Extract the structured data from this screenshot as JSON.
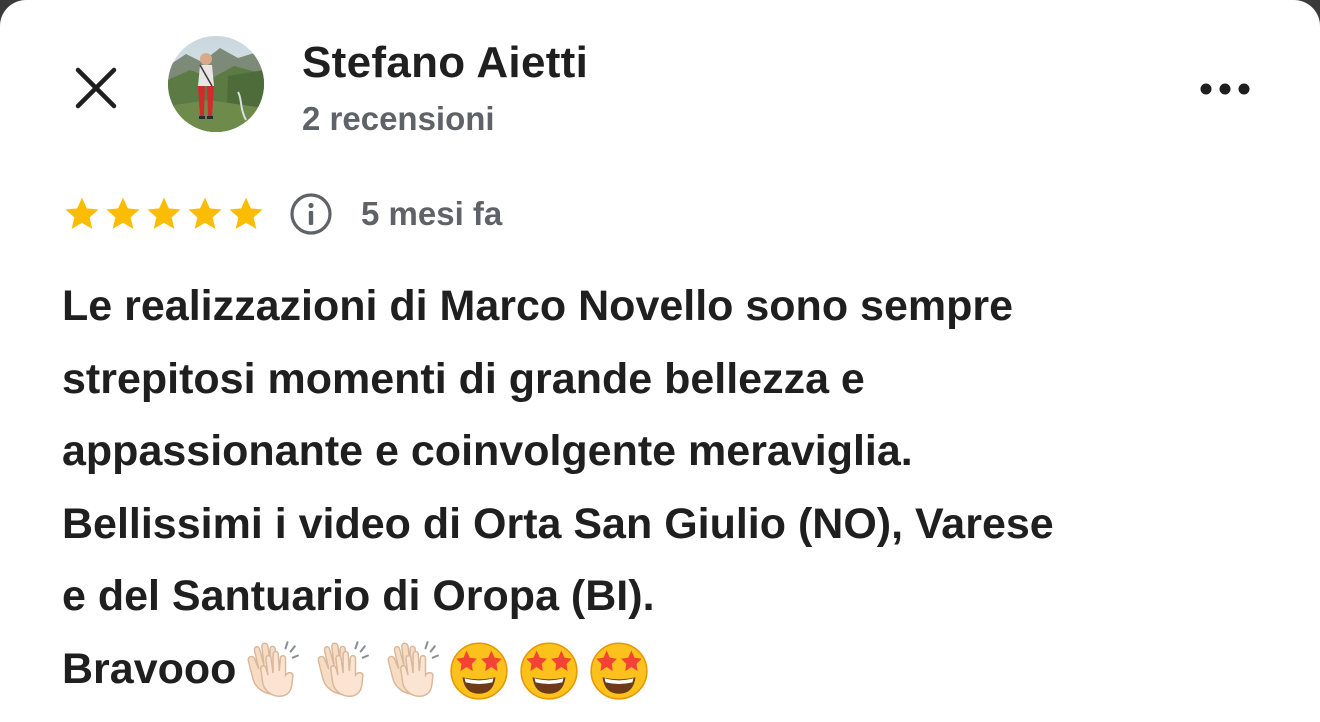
{
  "review": {
    "author": {
      "name": "Stefano Aietti",
      "meta": "2 recensioni"
    },
    "rating": 5,
    "rating_max": 5,
    "time_ago": "5 mesi fa",
    "text_lines": [
      "Le realizzazioni di Marco Novello sono sempre",
      "strepitosi momenti di grande bellezza e",
      "appassionante e coinvolgente meraviglia.",
      "Bellissimi i video di Orta San Giulio (NO), Varese",
      "e del Santuario di Oropa (BI).",
      "Bravooo"
    ],
    "trailing_emojis": [
      "clapping-hands-emoji",
      "clapping-hands-emoji",
      "clapping-hands-emoji",
      "star-struck-emoji",
      "star-struck-emoji",
      "star-struck-emoji"
    ]
  },
  "icons": {
    "close": "close-icon",
    "more": "more-horizontal-icon",
    "info": "info-icon",
    "star": "star-icon"
  },
  "colors": {
    "star": "#FBBC04",
    "primary_text": "#1F1F1F",
    "secondary_text": "#5F6368",
    "background": "#FFFFFF"
  }
}
